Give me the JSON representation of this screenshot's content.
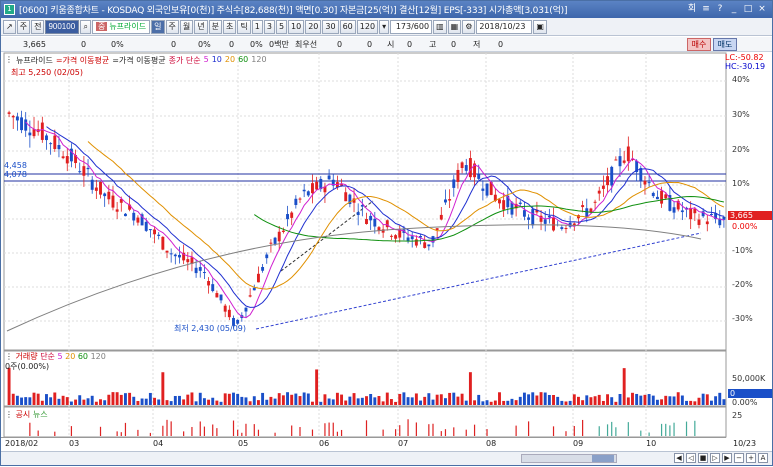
{
  "window": {
    "title": "[0600] 키움종합차트 - KOSDAQ 외국인보유[0(천)] 주식수[82,688(천)] 액면[0.30] 자본금[25(억)] 결산[12월] EPS[-333] 시가총액[3,031(억)]",
    "buttons": [
      "회",
      "≡",
      "?",
      "_",
      "□",
      "×"
    ]
  },
  "toolbar": {
    "left_buttons": [
      "↗",
      "주",
      "전"
    ],
    "code": "900100",
    "stock_tag": "중",
    "stock_name": "뉴프라이드",
    "period_buttons": [
      "일",
      "주",
      "월",
      "년",
      "분",
      "초",
      "틱"
    ],
    "active_period": "일",
    "minute_buttons": [
      "1",
      "3",
      "5",
      "10",
      "20",
      "30",
      "60",
      "120"
    ],
    "count": "173/600",
    "date": "2018/10/23"
  },
  "quote": {
    "price": "3,665",
    "v1": "0",
    "p1": "0%",
    "v2": "0",
    "p2": "0%",
    "v3": "0",
    "p3": "0%",
    "v4": "0백만",
    "label_priority": "최우선",
    "v5": "0",
    "v6": "0",
    "label_open": "시",
    "v7": "0",
    "label_high": "고",
    "v8": "0",
    "label_low": "저",
    "v9": "0",
    "buy": "매수",
    "sell": "매도"
  },
  "legend": {
    "name": "뉴프라이드",
    "ma_avg_a": "가격 이동평균",
    "ma_avg_b": "가격 이동평균",
    "ma_label": "종가 단순",
    "ma5": "5",
    "ma10": "10",
    "ma20": "20",
    "ma60": "60",
    "ma120": "120"
  },
  "right_info": {
    "lc": "LC:-50.82",
    "hc": "HC:-30.19"
  },
  "price_axis": [
    "40%",
    "30%",
    "20%",
    "10%",
    "0.00%",
    "-10%",
    "-20%",
    "-30%"
  ],
  "price_tag": "3,665",
  "annotations": {
    "high": "최고 5,250 (02/05)",
    "low": "최저 2,430 (05/09)",
    "left_value_a": "4,458",
    "left_value_b": "4,078"
  },
  "volume_panel": {
    "label": "거래량",
    "ma_label": "단순",
    "ma5": "5",
    "ma20": "20",
    "ma60": "60",
    "ma120": "120",
    "sub": "0주(0.00%)",
    "axis_top": "50,000K",
    "axis_tag": "0",
    "axis_bottom": "0.00%"
  },
  "notice_panel": {
    "label_a": "공시",
    "label_b": "뉴스",
    "axis": "25"
  },
  "x_axis": [
    "2018/02",
    "03",
    "04",
    "05",
    "06",
    "07",
    "08",
    "09",
    "10",
    "10/23"
  ],
  "colors": {
    "up": "#e02020",
    "down": "#1a4fc8",
    "ma5": "#d020d0",
    "ma10": "#2030d0",
    "ma20": "#e09000",
    "ma60": "#109010",
    "ma120": "#808080"
  }
}
